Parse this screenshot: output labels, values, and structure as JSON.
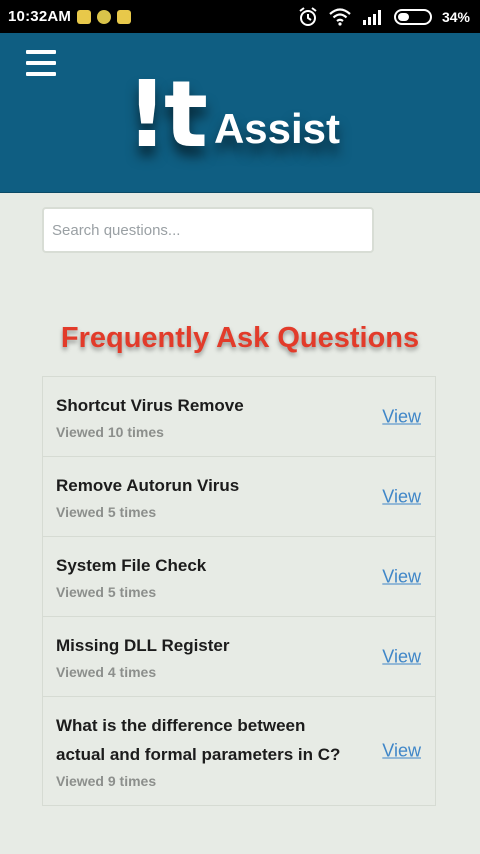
{
  "status_bar": {
    "time": "10:32AM",
    "battery": "34%"
  },
  "header": {
    "logo_mark": "!t",
    "logo_word": "Assist"
  },
  "search": {
    "placeholder": "Search questions..."
  },
  "faq": {
    "title": "Frequently Ask Questions",
    "items": [
      {
        "question": "Shortcut Virus Remove",
        "views": "Viewed 10 times",
        "link": "View"
      },
      {
        "question": "Remove Autorun Virus",
        "views": "Viewed 5 times",
        "link": "View"
      },
      {
        "question": "System File Check",
        "views": "Viewed 5 times",
        "link": "View"
      },
      {
        "question": "Missing DLL Register",
        "views": "Viewed 4 times",
        "link": "View"
      },
      {
        "question": "What is the difference between actual and formal parameters in C?",
        "views": "Viewed 9 times",
        "link": "View"
      }
    ]
  },
  "icons": {
    "menu": "hamburger-menu-icon",
    "alarm": "alarm-clock-icon",
    "wifi": "wifi-icon",
    "signal": "signal-bars-icon",
    "battery": "battery-icon"
  },
  "colors": {
    "header_bg": "#0f5e82",
    "page_bg": "#e7ebe5",
    "title_red": "#e23b2a",
    "link_blue": "#3f86c8"
  }
}
